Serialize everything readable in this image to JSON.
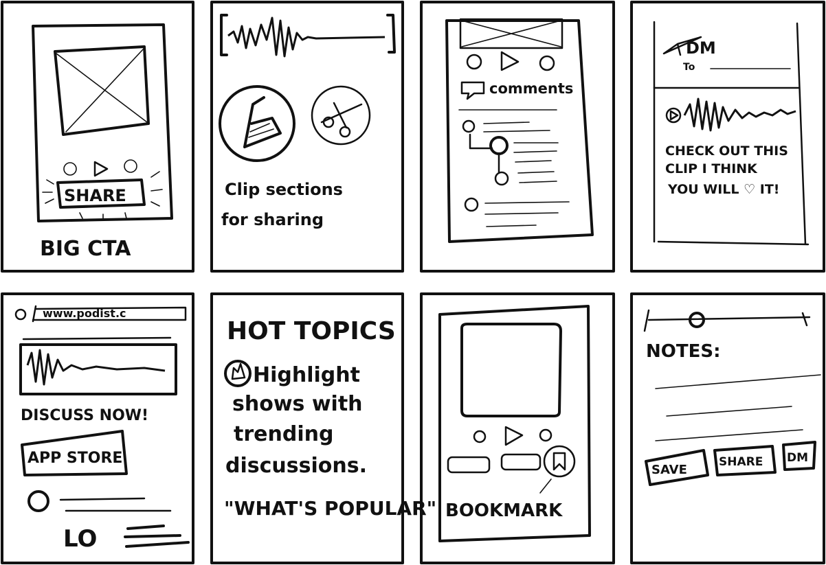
{
  "panels": [
    {
      "id": "big-cta",
      "labels": {
        "button": "SHARE",
        "caption": "BIG CTA"
      }
    },
    {
      "id": "clip",
      "labels": {
        "line1": "Clip sections",
        "line2": "for sharing"
      }
    },
    {
      "id": "comments",
      "labels": {
        "comments": "comments"
      }
    },
    {
      "id": "dm",
      "labels": {
        "dm": "DM",
        "to": "To",
        "msg1": "CHECK OUT THIS",
        "msg2": "CLIP I THINK",
        "msg3": "YOU WILL ♡ IT!"
      }
    },
    {
      "id": "web",
      "labels": {
        "url": "www.podist.c",
        "discuss": "DISCUSS NOW!",
        "appstore": "APP STORE"
      }
    },
    {
      "id": "hot-topics",
      "labels": {
        "title": "HOT TOPICS",
        "l1": "Highlight",
        "l2": "shows with",
        "l3": "trending",
        "l4": "discussions.",
        "quote": "\"WHAT'S POPULAR\""
      }
    },
    {
      "id": "bookmark",
      "labels": {
        "caption": "BOOKMARK"
      }
    },
    {
      "id": "notes",
      "labels": {
        "notes": "NOTES:",
        "save": "SAVE",
        "share": "SHARE",
        "dm": "DM"
      }
    }
  ]
}
